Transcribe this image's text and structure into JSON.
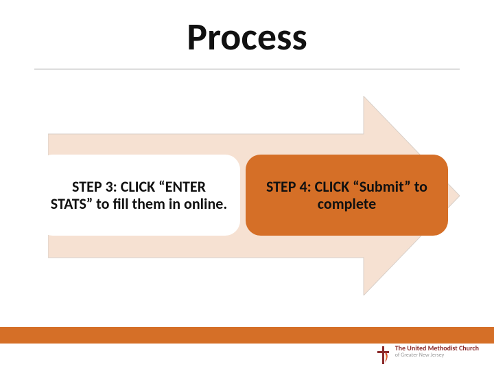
{
  "title": "Process",
  "steps": {
    "step3": "STEP 3: CLICK “ENTER STATS” to fill them in online.",
    "step4": "STEP 4:  CLICK “Submit” to complete"
  },
  "logo": {
    "line1": "The United Methodist Church",
    "line2": "of Greater New Jersey"
  },
  "colors": {
    "accent": "#d56f27",
    "arrowFill": "#f6e1d2",
    "logoRed": "#8a2a2a"
  }
}
